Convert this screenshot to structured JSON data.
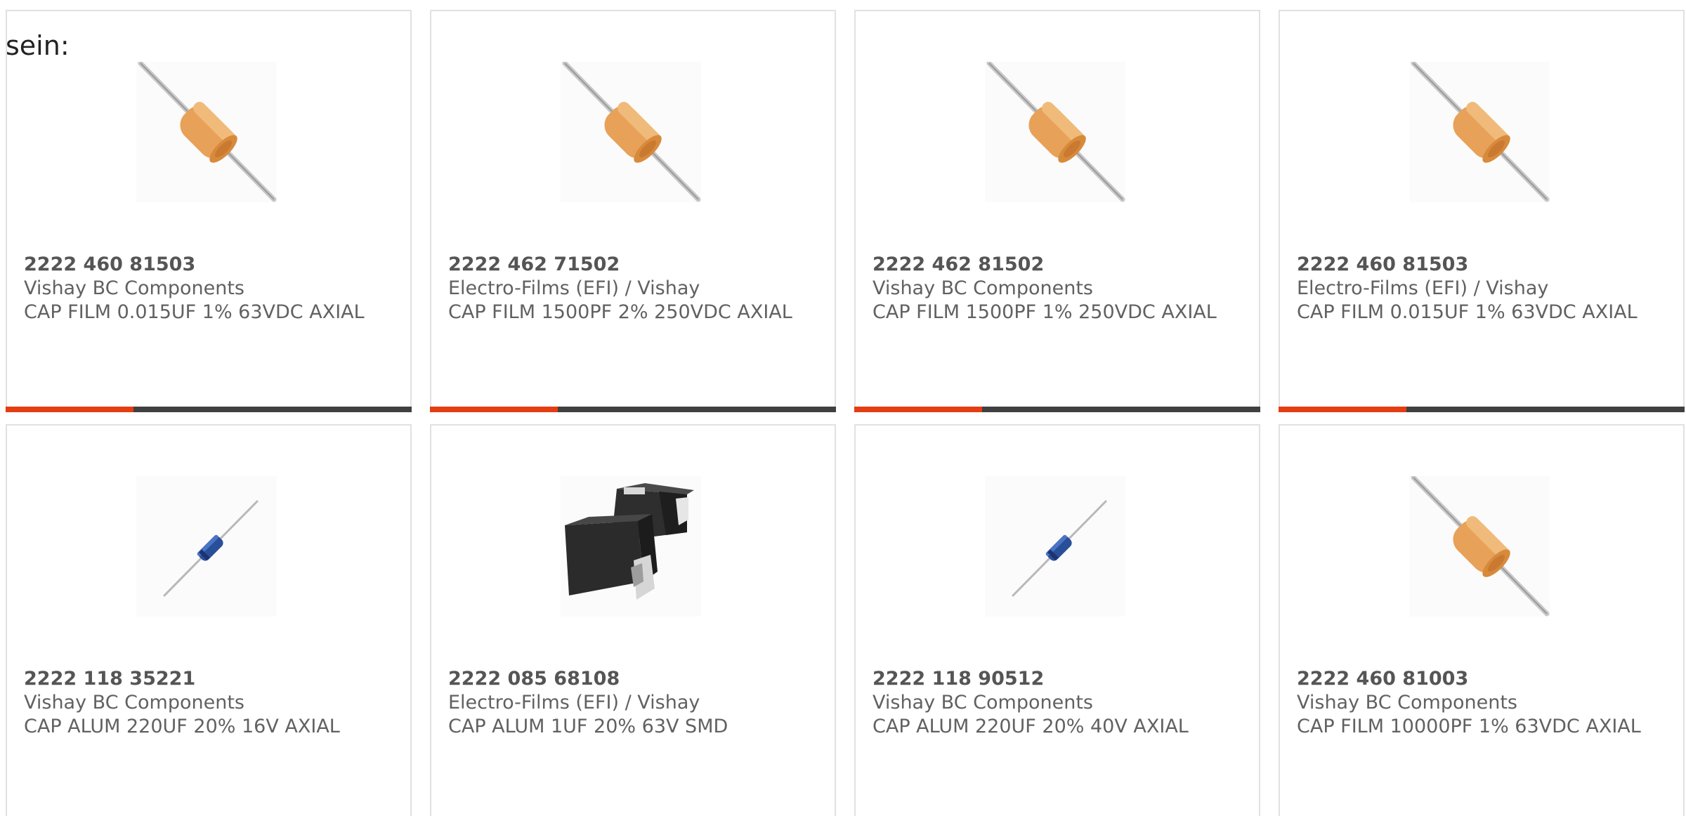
{
  "intro_text": "sein:",
  "accent_color": "#e43d12",
  "track_color": "#404040",
  "products": [
    {
      "part_number": "2222 460 81503",
      "manufacturer": "Vishay BC Components",
      "description": "CAP FILM 0.015UF 1% 63VDC AXIAL",
      "image_icon": "orange-axial-film-capacitor-icon",
      "progress": 0.315
    },
    {
      "part_number": "2222 462 71502",
      "manufacturer": "Electro-Films (EFI) / Vishay",
      "description": "CAP FILM 1500PF 2% 250VDC AXIAL",
      "image_icon": "orange-axial-film-capacitor-icon",
      "progress": 0.315
    },
    {
      "part_number": "2222 462 81502",
      "manufacturer": "Vishay BC Components",
      "description": "CAP FILM 1500PF 1% 250VDC AXIAL",
      "image_icon": "orange-axial-film-capacitor-icon",
      "progress": 0.315
    },
    {
      "part_number": "2222 460 81503",
      "manufacturer": "Electro-Films (EFI) / Vishay",
      "description": "CAP FILM 0.015UF 1% 63VDC AXIAL",
      "image_icon": "orange-axial-film-capacitor-icon",
      "progress": 0.315
    },
    {
      "part_number": "2222 118 35221",
      "manufacturer": "Vishay BC Components",
      "description": "CAP ALUM 220UF 20% 16V AXIAL",
      "image_icon": "blue-axial-electrolytic-capacitor-icon"
    },
    {
      "part_number": "2222 085 68108",
      "manufacturer": "Electro-Films (EFI) / Vishay",
      "description": "CAP ALUM 1UF 20% 63V SMD",
      "image_icon": "black-smd-capacitor-icon"
    },
    {
      "part_number": "2222 118 90512",
      "manufacturer": "Vishay BC Components",
      "description": "CAP ALUM 220UF 20% 40V AXIAL",
      "image_icon": "blue-axial-electrolytic-capacitor-icon"
    },
    {
      "part_number": "2222 460 81003",
      "manufacturer": "Vishay BC Components",
      "description": "CAP FILM 10000PF 1% 63VDC AXIAL",
      "image_icon": "orange-axial-film-capacitor-icon"
    }
  ]
}
